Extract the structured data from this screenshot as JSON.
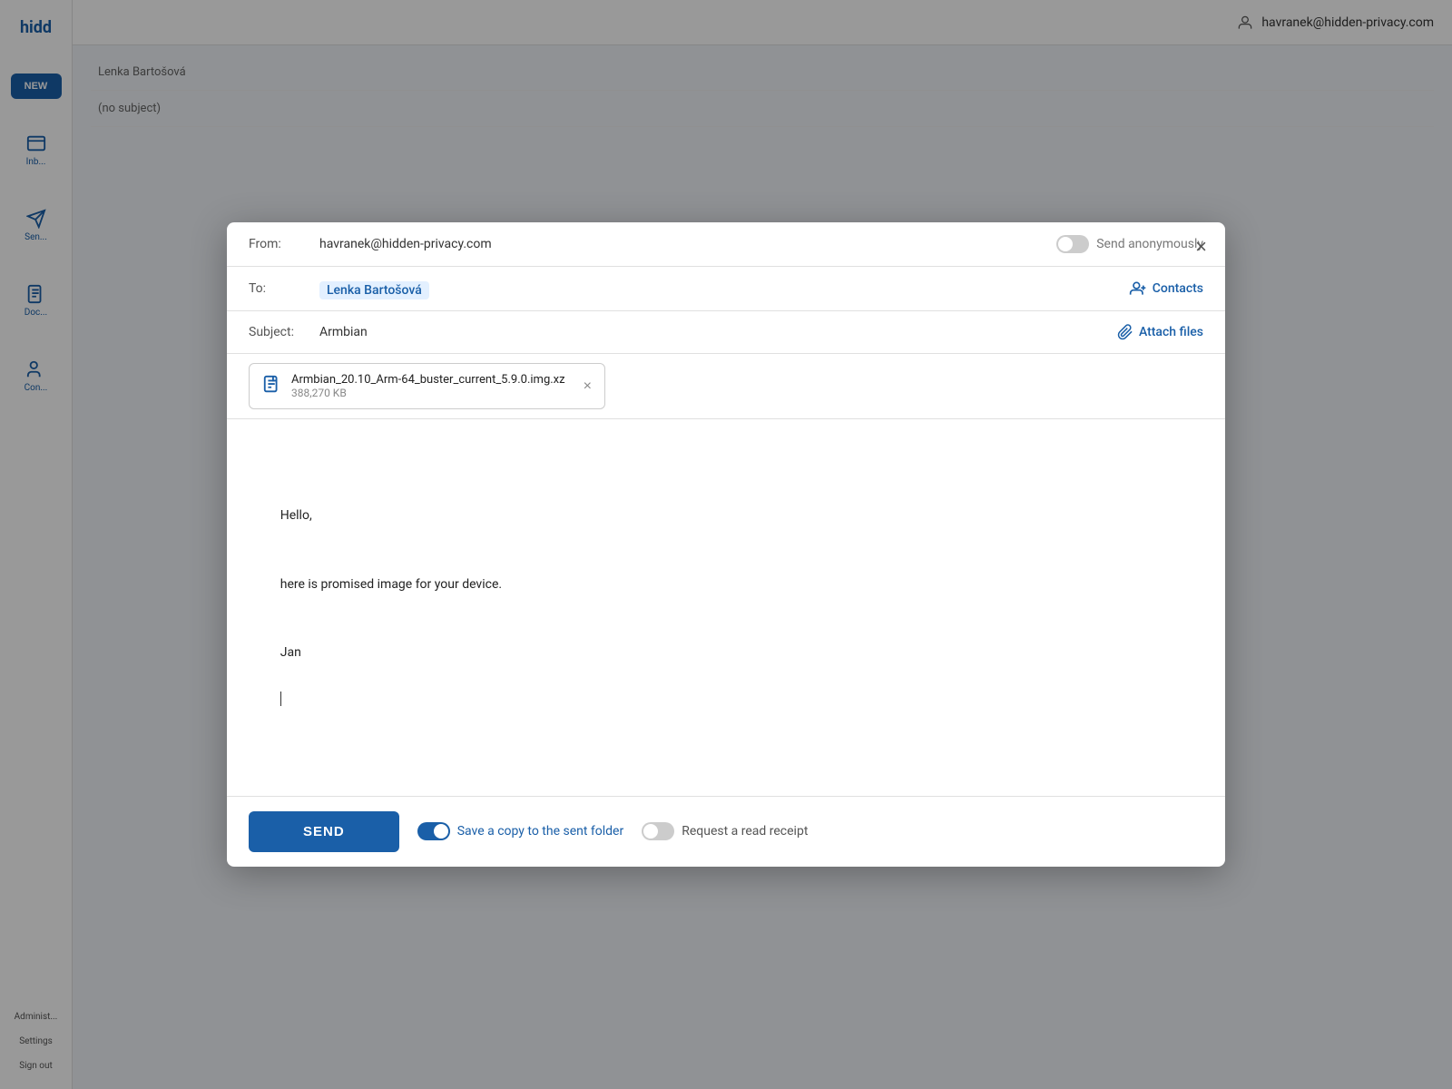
{
  "app": {
    "logo": "hidd",
    "user_email": "havranek@hidden-privacy.com"
  },
  "sidebar": {
    "new_button": "NEW",
    "items": [
      {
        "label": "Inbox",
        "icon": "inbox-icon"
      },
      {
        "label": "Sent",
        "icon": "sent-icon"
      },
      {
        "label": "Docs",
        "icon": "docs-icon"
      },
      {
        "label": "Con",
        "icon": "contacts-icon"
      }
    ],
    "bottom_items": [
      {
        "label": "Administ..."
      },
      {
        "label": "Settings"
      },
      {
        "label": "Sign out"
      }
    ]
  },
  "modal": {
    "close_label": "×",
    "from_label": "From:",
    "from_value": "havranek@hidden-privacy.com",
    "send_anonymously_label": "Send anonymously",
    "to_label": "To:",
    "to_recipient": "Lenka Bartošová",
    "contacts_label": "Contacts",
    "subject_label": "Subject:",
    "subject_value": "Armbian",
    "attach_files_label": "Attach files",
    "attachment": {
      "name": "Armbian_20.10_Arm-64_buster_current_5.9.0.img.xz",
      "size": "388,270 KB"
    },
    "body_lines": [
      "Hello,",
      "",
      "here is promised image for your device.",
      "",
      "Jan"
    ],
    "send_button": "SEND",
    "save_copy_label": "Save a copy to the sent folder",
    "read_receipt_label": "Request a read receipt",
    "save_copy_on": true,
    "read_receipt_on": false
  },
  "background": {
    "list_item_1": "Lenka Bartošová",
    "list_item_2": "(no subject)"
  }
}
